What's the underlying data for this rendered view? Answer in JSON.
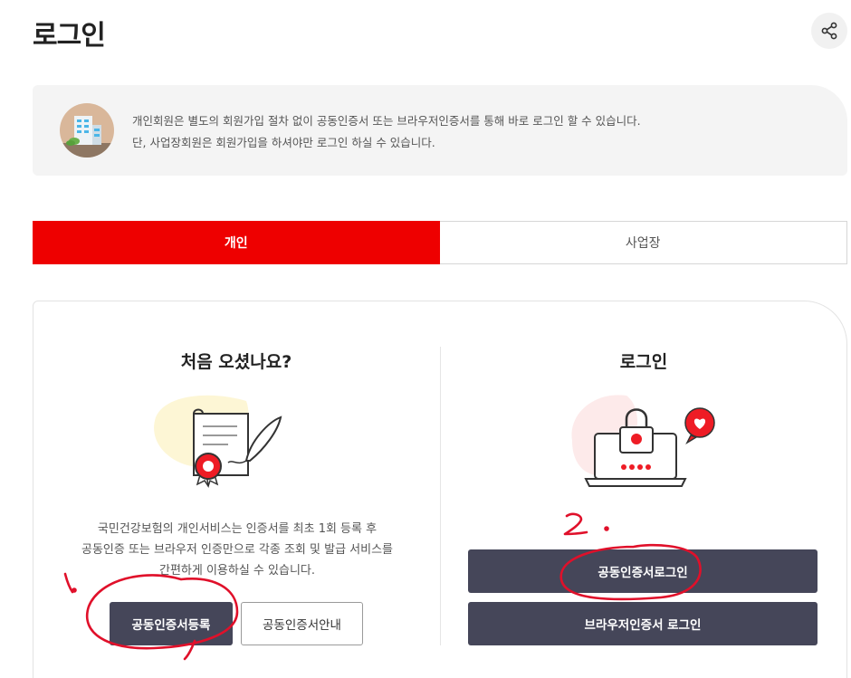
{
  "header": {
    "title": "로그인",
    "share_icon": "share-icon"
  },
  "notice": {
    "avatar_icon": "building-icon",
    "line1": "개인회원은 별도의 회원가입 절차 없이 공동인증서 또는 브라우저인증서를 통해 바로 로그인 할 수 있습니다.",
    "line2": "단, 사업장회원은 회원가입을 하셔야만 로그인 하실 수 있습니다."
  },
  "tabs": [
    {
      "label": "개인",
      "active": true
    },
    {
      "label": "사업장",
      "active": false
    }
  ],
  "left": {
    "title": "처음 오셨나요?",
    "illustration_icon": "certificate-scroll-icon",
    "desc1": "국민건강보험의 개인서비스는 인증서를 최초 1회 등록 후",
    "desc2": "공동인증 또는 브라우저 인증만으로 각종 조회 및 발급 서비스를",
    "desc3": "간편하게 이용하실 수 있습니다.",
    "register_button": "공동인증서등록",
    "guide_button": "공동인증서안내"
  },
  "right": {
    "title": "로그인",
    "illustration_icon": "laptop-lock-icon",
    "joint_login_button": "공동인증서로그인",
    "browser_login_button": "브라우저인증서 로그인"
  },
  "annotations": {
    "mark1": "1.",
    "mark2": "2."
  },
  "colors": {
    "accent_red": "#ee0000",
    "button_dark": "#454659",
    "annotation_red": "#e0102a"
  }
}
